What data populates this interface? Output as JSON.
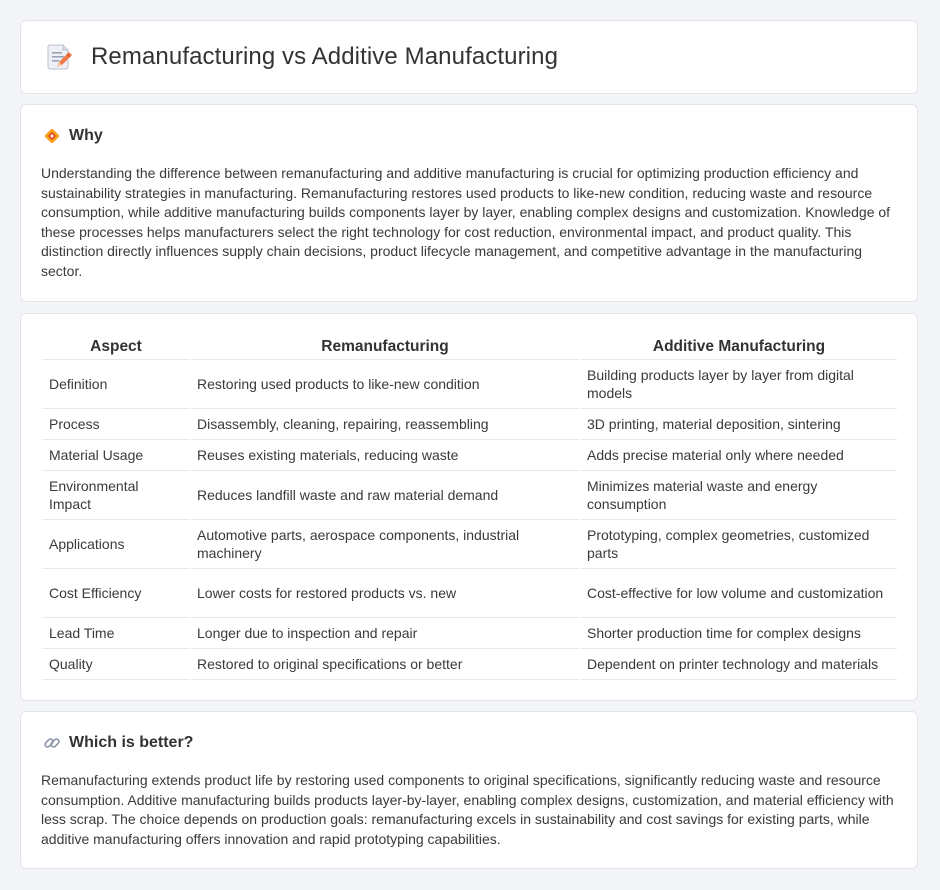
{
  "header": {
    "title": "Remanufacturing vs Additive Manufacturing",
    "icon": "document-pencil-icon"
  },
  "why": {
    "heading": "Why",
    "icon": "diamond-warning-icon",
    "text": "Understanding the difference between remanufacturing and additive manufacturing is crucial for optimizing production efficiency and sustainability strategies in manufacturing. Remanufacturing restores used products to like-new condition, reducing waste and resource consumption, while additive manufacturing builds components layer by layer, enabling complex designs and customization. Knowledge of these processes helps manufacturers select the right technology for cost reduction, environmental impact, and product quality. This distinction directly influences supply chain decisions, product lifecycle management, and competitive advantage in the manufacturing sector."
  },
  "comparison": {
    "headers": [
      "Aspect",
      "Remanufacturing",
      "Additive Manufacturing"
    ],
    "rows": [
      [
        "Definition",
        "Restoring used products to like-new condition",
        "Building products layer by layer from digital models"
      ],
      [
        "Process",
        "Disassembly, cleaning, repairing, reassembling",
        "3D printing, material deposition, sintering"
      ],
      [
        "Material Usage",
        "Reuses existing materials, reducing waste",
        "Adds precise material only where needed"
      ],
      [
        "Environmental Impact",
        "Reduces landfill waste and raw material demand",
        "Minimizes material waste and energy consumption"
      ],
      [
        "Applications",
        "Automotive parts, aerospace components, industrial machinery",
        "Prototyping, complex geometries, customized parts"
      ],
      [
        "Cost Efficiency",
        "Lower costs for restored products vs. new",
        "Cost-effective for low volume and customization"
      ],
      [
        "Lead Time",
        "Longer due to inspection and repair",
        "Shorter production time for complex designs"
      ],
      [
        "Quality",
        "Restored to original specifications or better",
        "Dependent on printer technology and materials"
      ]
    ]
  },
  "better": {
    "heading": "Which is better?",
    "icon": "link-icon",
    "text": "Remanufacturing extends product life by restoring used components to original specifications, significantly reducing waste and resource consumption. Additive manufacturing builds products layer-by-layer, enabling complex designs, customization, and material efficiency with less scrap. The choice depends on production goals: remanufacturing excels in sustainability and cost savings for existing parts, while additive manufacturing offers innovation and rapid prototyping capabilities."
  }
}
